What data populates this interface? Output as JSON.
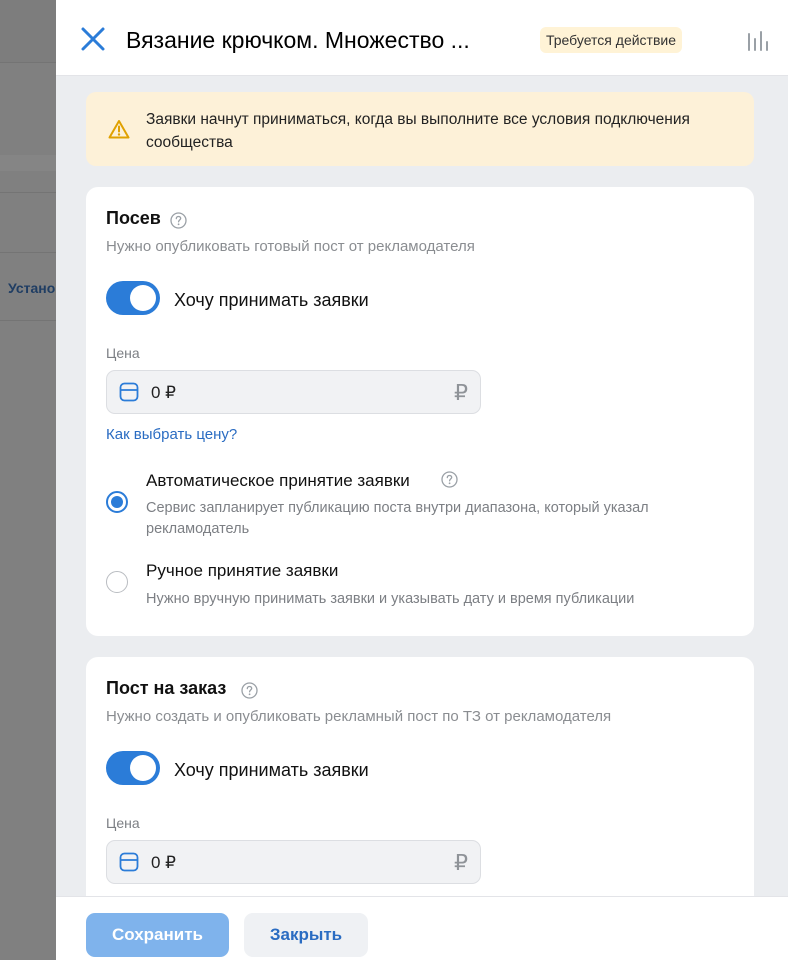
{
  "background": {
    "partial_text": "Устано"
  },
  "header": {
    "title": "Вязание крючком. Множество ...",
    "status_badge": "Требуется действие",
    "close_icon": "close-icon",
    "stats_icon": "bar-chart-icon"
  },
  "warning": {
    "icon": "warning-icon",
    "text": "Заявки начнут приниматься, когда вы выполните все условия подключения сообщества"
  },
  "sections": [
    {
      "title": "Посев",
      "subtitle": "Нужно опубликовать готовый пост от рекламодателя",
      "toggle_label": "Хочу принимать заявки",
      "toggle_on": true,
      "price_label": "Цена",
      "price_value": "0 ₽",
      "currency_icon": "₽",
      "price_help_link": "Как выбрать цену?",
      "options": [
        {
          "title": "Автоматическое принятие заявки",
          "description": "Сервис запланирует публикацию поста внутри диапазона, который указал рекламодатель",
          "selected": true
        },
        {
          "title": "Ручное принятие заявки",
          "description": "Нужно вручную принимать заявки и указывать дату и время публикации",
          "selected": false
        }
      ]
    },
    {
      "title": "Пост на заказ",
      "subtitle": "Нужно создать и опубликовать рекламный пост по ТЗ от рекламодателя",
      "toggle_label": "Хочу принимать заявки",
      "toggle_on": true,
      "price_label": "Цена",
      "price_value": "0 ₽",
      "currency_icon": "₽"
    }
  ],
  "footer": {
    "save_label": "Сохранить",
    "close_label": "Закрыть"
  },
  "colors": {
    "accent": "#2b7cd8",
    "link": "#2a6cc2",
    "warning_bg": "#fdf1d8",
    "badge_bg": "#fff3d6"
  }
}
